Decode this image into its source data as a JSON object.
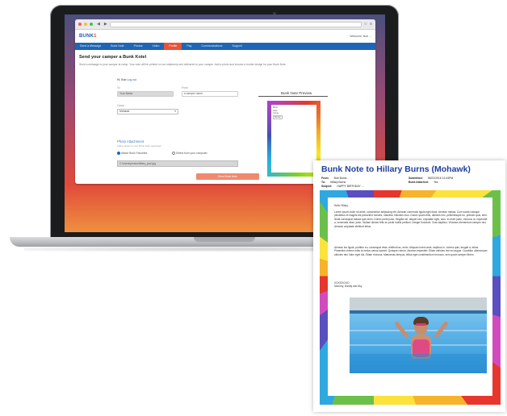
{
  "browser": {
    "url": "",
    "logo_main": "BUNK",
    "logo_accent": "1",
    "header_right": "Welcome, Bob ...",
    "nav": [
      "Send a Message",
      "Bunk Note",
      "Photos",
      "Video",
      "Profile",
      "Pay",
      "Communications",
      "Support"
    ],
    "nav_active_index": 4
  },
  "page": {
    "heading": "Send your camper a Bunk Kotel",
    "intro": "Send a message to your camper at camp. Your note will be printed on our stationery and delivered to your camper. Add a photo and choose a border design for your Bunk Note.",
    "hi_text": "Hi, Bob",
    "hi_link": "Log out",
    "field1_label": "To",
    "field1_value": "Your Name",
    "field2_label": "From",
    "field2_value": "a camper name",
    "field3_label": "Camp",
    "field3_value": "Mohawk",
    "photo_title": "Photo Attachment",
    "photo_sub": "Add a photo to your Bunk Note (optional)",
    "radio1": "Attach Bunk Favorites",
    "radio2": "Select from your computer",
    "file_value": "C:\\Users\\photos\\hillary_pool.jpg",
    "submit": "Send Bunk Note",
    "preview_label": "Bunk Note Preview",
    "preview_lines": [
      "Bunk",
      "Note",
      "Camp"
    ],
    "preview_select": "Border"
  },
  "note": {
    "title": "Bunk Note to Hillary Burns (Mohawk)",
    "meta": [
      {
        "k": "From:",
        "v": "Bob Burns"
      },
      {
        "k": "To:",
        "v": "Hillary Burns"
      },
      {
        "k": "Subject:",
        "v": "HAPPY BIRTHDAY ...."
      },
      {
        "k": "Submitted:",
        "v": "06/22/2016 12:44PM"
      },
      {
        "k": "Bunk Attached:",
        "v": "Yes"
      }
    ],
    "greeting": "Hello Hillary,",
    "para1": "Lorem ipsum dolor sit amet, consectetur adipiscing elit. Aenean commodo ligula eget dolor. Aenean massa. Cum sociis natoque penatibus et magnis dis parturient montes, nascetur ridiculus mus. Donec quam felis, ultricies nec, pellentesque eu, pretium quis, sem. Nulla consequat massa quis enim. Donec pede justo, fringilla vel, aliquet nec, vulputate eget, arcu. In enim justo, rhoncus ut, imperdiet a, venenatis vitae, justo. Nullam dictum felis eu pede mollis pretium. Integer tincidunt. Cras dapibus. Vivamus elementum semper nisi. Aenean vulputate eleifend tellus.",
    "para2": "Aenean leo ligula, porttitor eu, consequat vitae, eleifend ac, enim. Aliquam lorem ante, dapibus in, viverra quis, feugiat a, tellus. Phasellus viverra nulla ut metus varius laoreet. Quisque rutrum. Aenean imperdiet. Etiam ultricies nisi vel augue. Curabitur ullamcorper ultricies nisi. Nam eget dui. Etiam rhoncus. Maecenas tempus, tellus eget condimentum rhoncus, sem quam semper libero.",
    "sign1": "XOXOXOXO",
    "sign2": "Mommy, Daddy and Sky"
  }
}
